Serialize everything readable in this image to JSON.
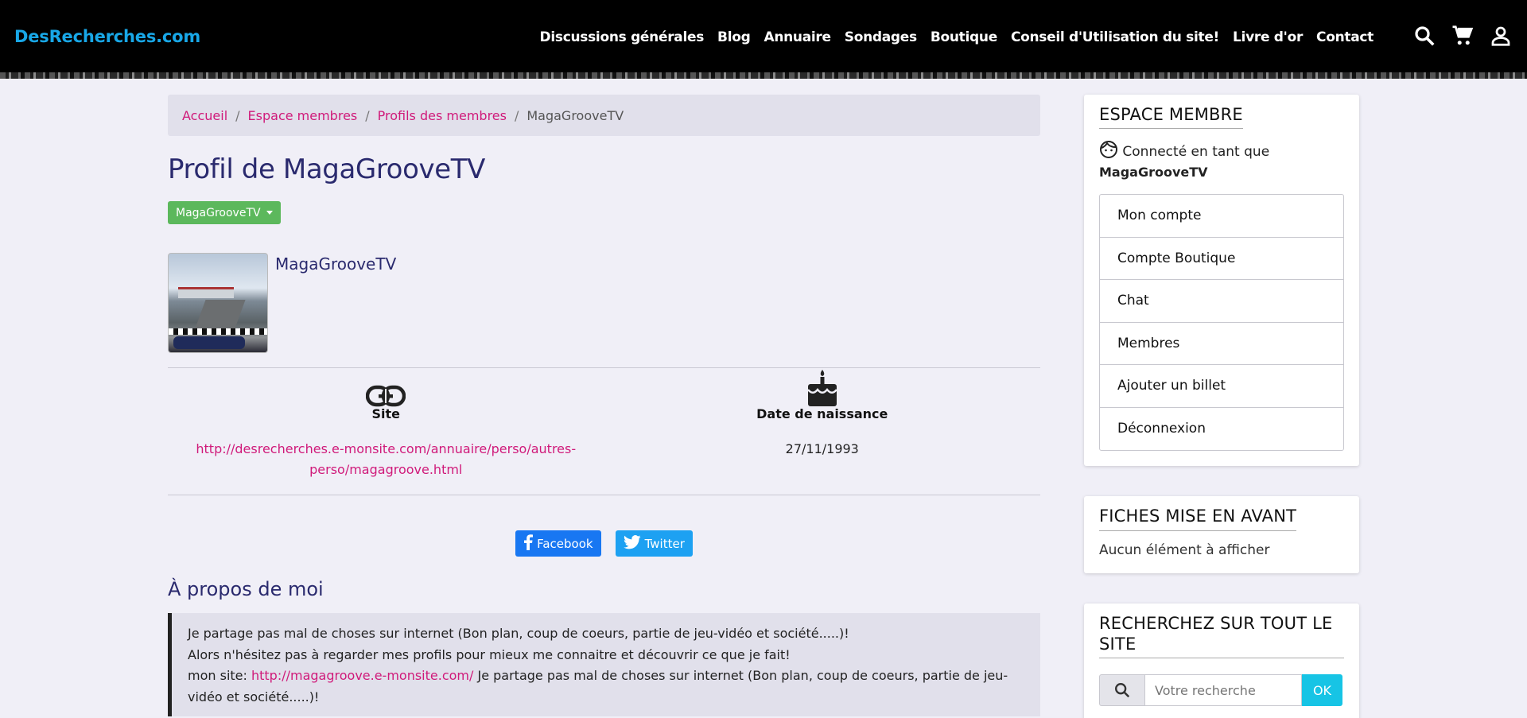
{
  "header": {
    "brand": "DesRecherches.com",
    "nav": [
      "Discussions générales",
      "Blog",
      "Annuaire",
      "Sondages",
      "Boutique",
      "Conseil d'Utilisation du site!",
      "Livre d'or",
      "Contact"
    ],
    "icons": [
      "search-icon",
      "cart-icon",
      "user-icon"
    ]
  },
  "breadcrumb": {
    "items": [
      "Accueil",
      "Espace membres",
      "Profils des membres"
    ],
    "current": "MagaGrooveTV",
    "separator": "/"
  },
  "profile": {
    "title": "Profil de MagaGrooveTV",
    "dropdown_label": "MagaGrooveTV",
    "name": "MagaGrooveTV",
    "site_label": "Site",
    "site_url": "http://desrecherches.e-monsite.com/annuaire/perso/autres-perso/magagroove.html",
    "birthdate_label": "Date de naissance",
    "birthdate": "27/11/1993"
  },
  "share": {
    "facebook": "Facebook",
    "twitter": "Twitter"
  },
  "about": {
    "title": "À propos de moi",
    "line1": "Je partage pas mal de choses sur internet (Bon plan, coup de coeurs, partie de jeu-vidéo et société.....)!",
    "line2": "Alors n'hésitez pas à regarder mes profils pour mieux me connaitre et découvrir ce que je fait!",
    "line3_prefix": "mon site: ",
    "line3_link": "http://magagroove.e-monsite.com/",
    "line3_suffix": " Je partage pas mal de choses sur internet (Bon plan, coup de coeurs, partie de jeu-vidéo et société.....)!"
  },
  "sidebar": {
    "member_title": "ESPACE MEMBRE",
    "connected_prefix": "Connecté en tant que",
    "connected_user": "MagaGrooveTV",
    "menu": [
      "Mon compte",
      "Compte Boutique",
      "Chat",
      "Membres",
      "Ajouter un billet",
      "Déconnexion"
    ],
    "featured_title": "FICHES MISE EN AVANT",
    "featured_empty": "Aucun élément à afficher",
    "search_title": "RECHERCHEZ SUR TOUT LE SITE",
    "search_placeholder": "Votre recherche",
    "search_button": "OK"
  },
  "colors": {
    "brand": "#18a7e7",
    "link": "#d01a7a",
    "title": "#2a2a6e",
    "success": "#5cb85c",
    "facebook": "#1877f2",
    "twitter": "#1da1f2",
    "search_button": "#17c4e5"
  }
}
